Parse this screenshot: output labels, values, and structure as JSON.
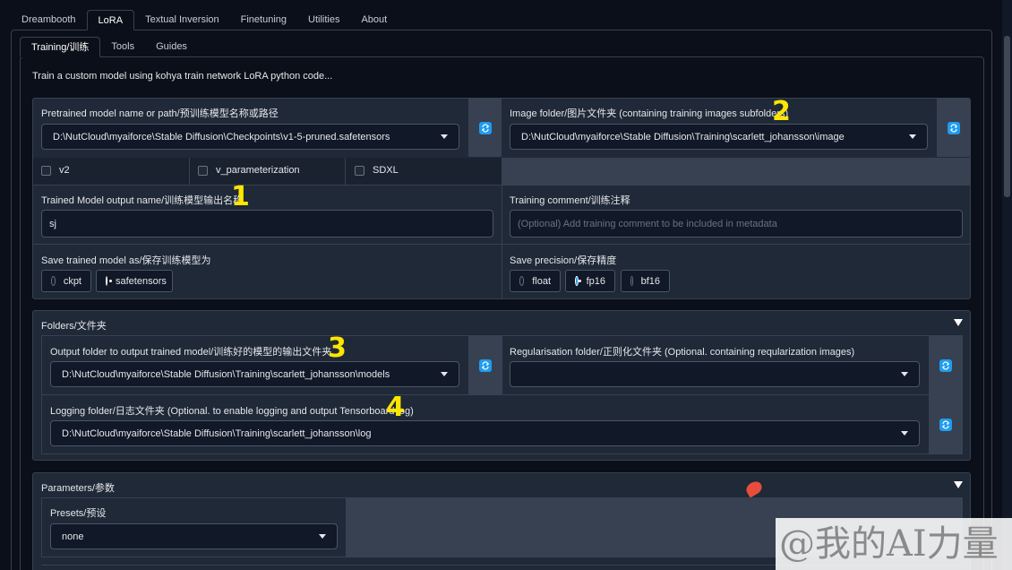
{
  "top_tabs": [
    "Dreambooth",
    "LoRA",
    "Textual Inversion",
    "Finetuning",
    "Utilities",
    "About"
  ],
  "sub_tabs": [
    "Training/训练",
    "Tools",
    "Guides"
  ],
  "description": "Train a custom model using kohya train network LoRA python code...",
  "pretrained": {
    "label": "Pretrained model name or path/预训练模型名称或路径",
    "value": "D:\\NutCloud\\myaiforce\\Stable Diffusion\\Checkpoints\\v1-5-pruned.safetensors"
  },
  "image_folder": {
    "label": "Image folder/图片文件夹 (containing training images subfolders)",
    "value": "D:\\NutCloud\\myaiforce\\Stable Diffusion\\Training\\scarlett_johansson\\image"
  },
  "checks": [
    "v2",
    "v_parameterization",
    "SDXL"
  ],
  "output_name": {
    "label": "Trained Model output name/训练模型输出名称",
    "value": "sj"
  },
  "training_comment": {
    "label": "Training comment/训练注释",
    "placeholder": "(Optional) Add training comment to be included in metadata"
  },
  "save_as": {
    "label": "Save trained model as/保存训练模型为",
    "options": [
      "ckpt",
      "safetensors"
    ],
    "selected": "safetensors"
  },
  "save_precision": {
    "label": "Save precision/保存精度",
    "options": [
      "float",
      "fp16",
      "bf16"
    ],
    "selected": "fp16"
  },
  "folders": {
    "title": "Folders/文件夹",
    "output": {
      "label": "Output folder to output trained model/训练好的模型的输出文件夹",
      "value": "D:\\NutCloud\\myaiforce\\Stable Diffusion\\Training\\scarlett_johansson\\models"
    },
    "regularisation": {
      "label": "Regularisation folder/正则化文件夹 (Optional. containing reqularization images)",
      "value": ""
    },
    "logging": {
      "label": "Logging folder/日志文件夹 (Optional. to enable logging and output Tensorboard log)",
      "value": "D:\\NutCloud\\myaiforce\\Stable Diffusion\\Training\\scarlett_johansson\\log"
    }
  },
  "parameters": {
    "title": "Parameters/参数",
    "presets_label": "Presets/预设",
    "presets_value": "none"
  },
  "annotations": [
    "1",
    "2",
    "3",
    "4"
  ],
  "watermark": "@我的AI力量",
  "colors": {
    "accent": "#1f9cf0",
    "annotation": "#ffe600",
    "background": "#0b0f19",
    "card": "#1f2937"
  }
}
